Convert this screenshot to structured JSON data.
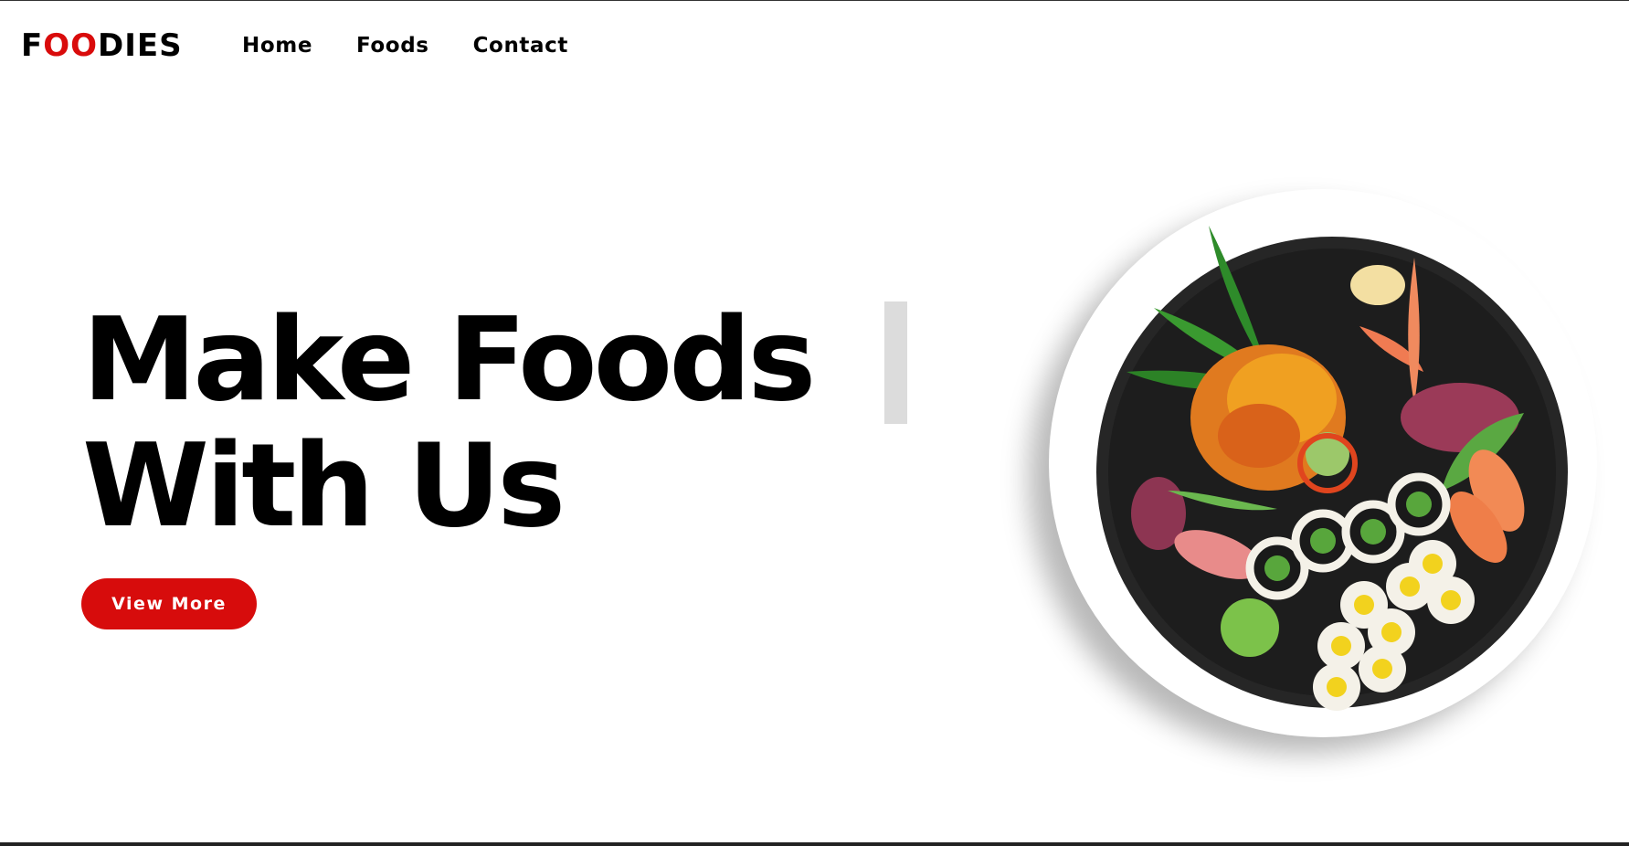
{
  "brand": {
    "logo_prefix": "F",
    "logo_accent": "OO",
    "logo_suffix": "DIES",
    "accent_color": "#d90b0b"
  },
  "nav": {
    "items": [
      {
        "label": "Home"
      },
      {
        "label": "Foods"
      },
      {
        "label": "Contact"
      }
    ]
  },
  "hero": {
    "headline_line1": "Make Foods",
    "headline_line2": "With Us",
    "cta_label": "View More",
    "cta_color": "#d70c0c",
    "image_icon": "sushi-plate-image"
  }
}
